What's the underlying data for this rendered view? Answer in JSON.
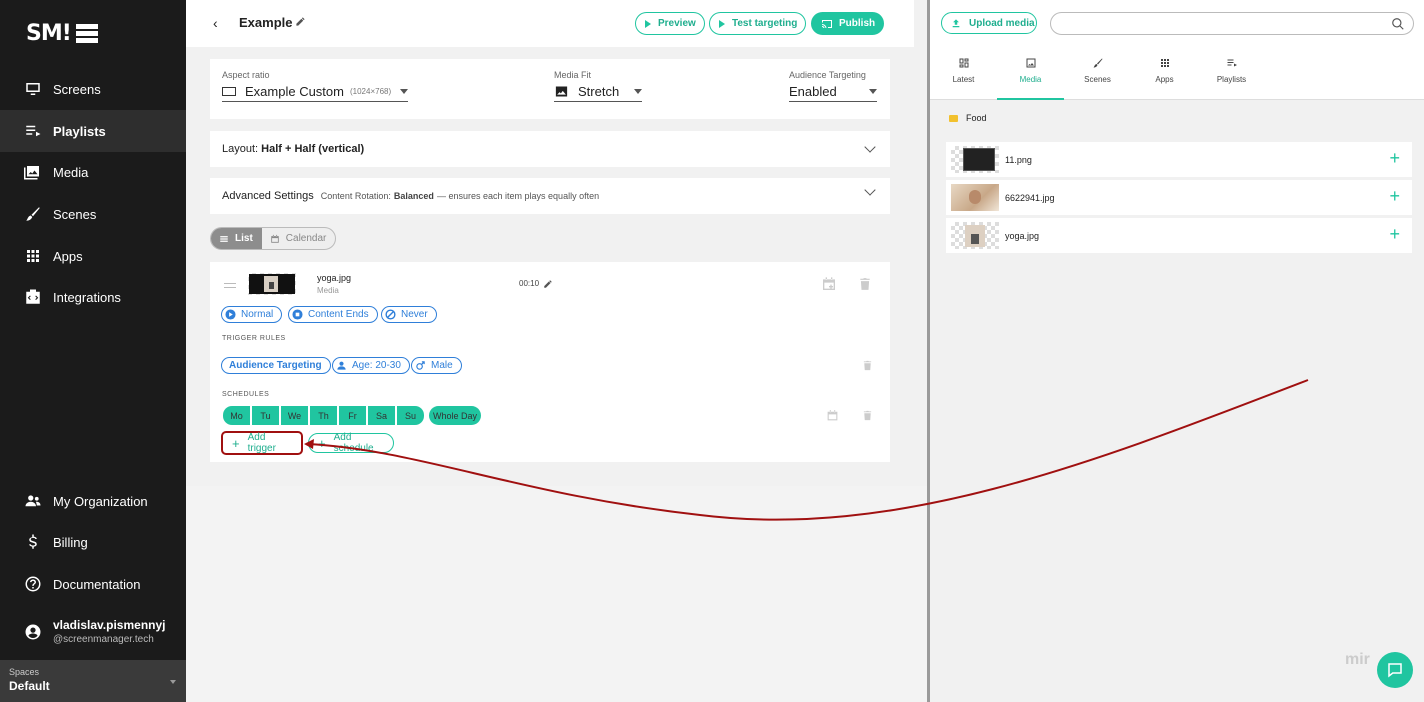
{
  "sidebar": {
    "logo": "SM!",
    "items": [
      {
        "label": "Screens",
        "icon": "monitor-icon"
      },
      {
        "label": "Playlists",
        "icon": "playlist-icon"
      },
      {
        "label": "Media",
        "icon": "image-library-icon"
      },
      {
        "label": "Scenes",
        "icon": "brush-icon"
      },
      {
        "label": "Apps",
        "icon": "grid-icon"
      },
      {
        "label": "Integrations",
        "icon": "integration-icon"
      }
    ],
    "bottom": [
      {
        "label": "My Organization",
        "icon": "people-icon"
      },
      {
        "label": "Billing",
        "icon": "dollar-icon"
      },
      {
        "label": "Documentation",
        "icon": "help-icon"
      }
    ],
    "user": {
      "name": "vladislav.pismennyj",
      "email": "@screenmanager.tech"
    },
    "spaces": {
      "label": "Spaces",
      "value": "Default"
    }
  },
  "header": {
    "title": "Example",
    "preview": "Preview",
    "test_targeting": "Test targeting",
    "publish": "Publish"
  },
  "settings": {
    "aspect_label": "Aspect ratio",
    "aspect_value": "Example Custom",
    "aspect_dims": "(1024×768)",
    "fit_label": "Media Fit",
    "fit_value": "Stretch",
    "aud_label": "Audience Targeting",
    "aud_value": "Enabled"
  },
  "layout": {
    "label": "Layout:",
    "value": "Half + Half (vertical)"
  },
  "advanced": {
    "label": "Advanced Settings",
    "rot_label": "Content Rotation:",
    "rot_value": "Balanced",
    "rot_desc": "— ensures each item plays equally often"
  },
  "view_toggle": {
    "list": "List",
    "calendar": "Calendar"
  },
  "item": {
    "name": "yoga.jpg",
    "type": "Media",
    "duration": "00:10",
    "chips": [
      "Normal",
      "Content Ends",
      "Never"
    ],
    "trigger_rules_title": "TRIGGER RULES",
    "audience_chip": "Audience Targeting",
    "age_chip": "Age: 20-30",
    "gender_chip": "Male",
    "schedules_title": "SCHEDULES",
    "days": [
      "Mo",
      "Tu",
      "We",
      "Th",
      "Fr",
      "Sa",
      "Su"
    ],
    "whole_day": "Whole Day",
    "add_trigger": "Add trigger",
    "add_schedule": "Add schedule"
  },
  "right": {
    "upload": "Upload media",
    "search_placeholder": "",
    "tabs": [
      {
        "label": "Latest",
        "icon": "dashboard-icon"
      },
      {
        "label": "Media",
        "icon": "image-library-icon"
      },
      {
        "label": "Scenes",
        "icon": "brush-icon"
      },
      {
        "label": "Apps",
        "icon": "grid-icon"
      },
      {
        "label": "Playlists",
        "icon": "playlist-icon"
      }
    ],
    "active_tab": "Media",
    "folder": "Food",
    "files": [
      "11.png",
      "6622941.jpg",
      "yoga.jpg"
    ]
  },
  "watermark": "mir",
  "colors": {
    "accent": "#20c5a0",
    "link": "#2f7fd9",
    "sidebar": "#1b1b1b",
    "annotation": "#a01010"
  }
}
